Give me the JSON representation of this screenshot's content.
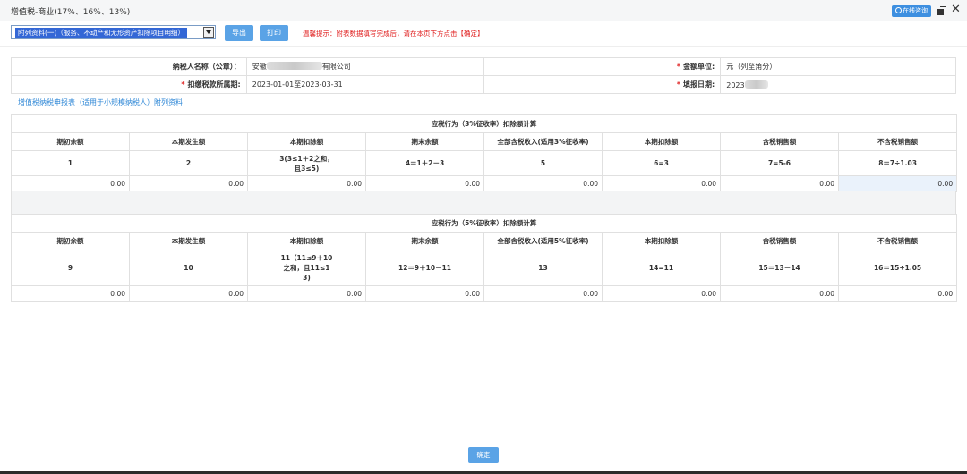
{
  "window": {
    "title": "增值税-商业(17%、16%、13%)",
    "online_consult": "在线咨询",
    "close_glyph": "✕"
  },
  "toolbar": {
    "select_value": "附列资料(一)（服务、不动产和无形资产扣除项目明细）",
    "export_label": "导出",
    "print_label": "打印",
    "tip": "温馨提示：附表数据填写完成后，请在本页下方点击【确定】"
  },
  "info": {
    "taxpayer_label": "纳税人名称（公章）：",
    "taxpayer_prefix": "安徽",
    "taxpayer_suffix": "有限公司",
    "unit_label": "金额单位:",
    "unit_value": "元（列至角分）",
    "period_label": "扣缴税款所属期:",
    "period_value": "2023-01-01至2023-03-31",
    "fill_date_label": "填报日期:",
    "fill_date_value": "2023",
    "required_mark": "*"
  },
  "section_title": "增值税纳税申报表（适用于小规模纳税人）附列资料",
  "table1": {
    "caption": "应税行为（3%征收率）扣除额计算",
    "headers": [
      "期初余额",
      "本期发生额",
      "本期扣除额",
      "期末余额",
      "全部含税收入(适用3%征收率)",
      "本期扣除额",
      "含税销售额",
      "不含税销售额"
    ],
    "formulas": [
      "1",
      "2",
      "3(3≤1＋2之和，\n且3≤5)",
      "4＝1＋2－3",
      "5",
      "6=3",
      "7=5-6",
      "8＝7÷1.03"
    ],
    "values": [
      "0.00",
      "0.00",
      "0.00",
      "0.00",
      "0.00",
      "0.00",
      "0.00",
      "0.00"
    ]
  },
  "table2": {
    "caption": "应税行为（5%征收率）扣除额计算",
    "headers": [
      "期初余额",
      "本期发生额",
      "本期扣除额",
      "期末余额",
      "全部含税收入(适用5%征收率)",
      "本期扣除额",
      "含税销售额",
      "不含税销售额"
    ],
    "formulas": [
      "9",
      "10",
      "11（11≤9＋10\n之和，且11≤1\n3)",
      "12＝9＋10－11",
      "13",
      "14=11",
      "15＝13－14",
      "16＝15÷1.05"
    ],
    "values": [
      "0.00",
      "0.00",
      "0.00",
      "0.00",
      "0.00",
      "0.00",
      "0.00",
      "0.00"
    ]
  },
  "confirm_label": "确定"
}
